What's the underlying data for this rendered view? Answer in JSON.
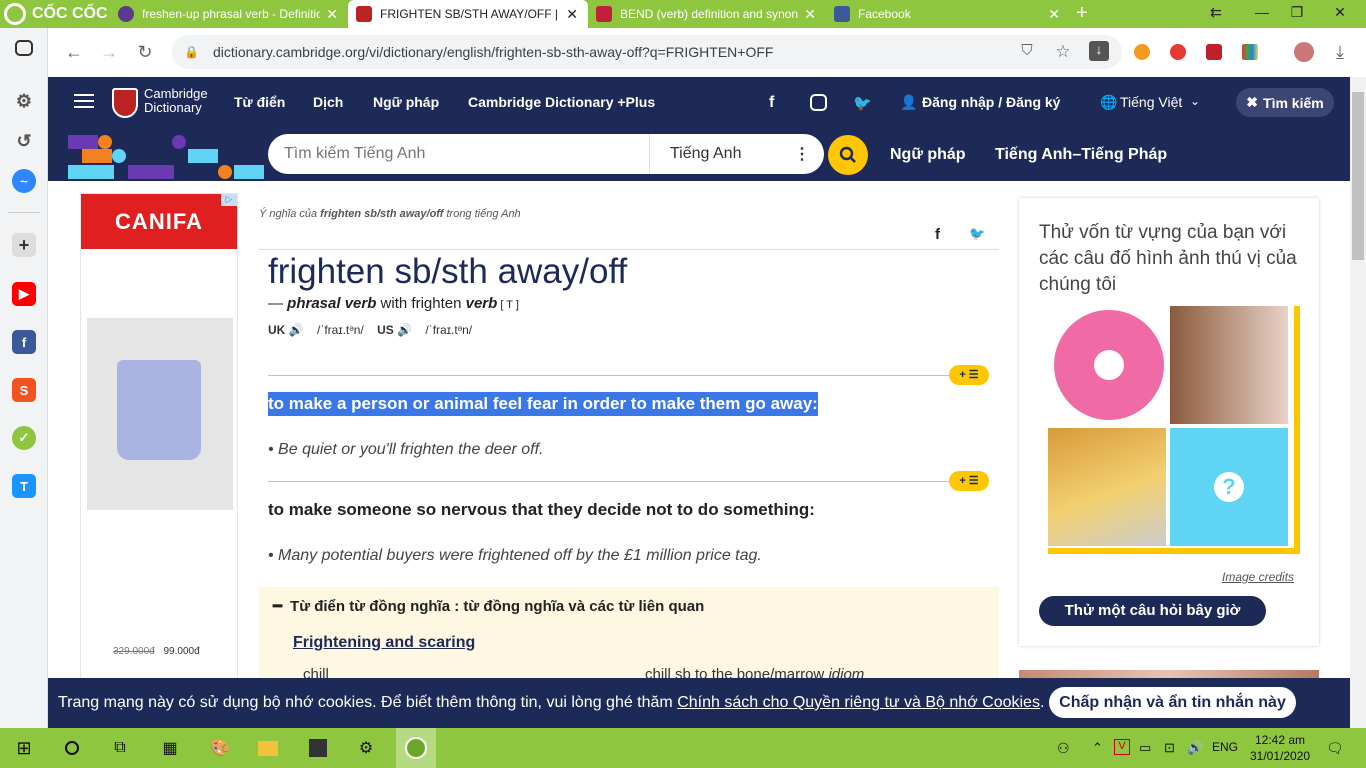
{
  "browser": {
    "logo": "CỐC CỐC",
    "tabs": [
      {
        "title": "freshen-up phrasal verb - Definitio",
        "active": false
      },
      {
        "title": "FRIGHTEN SB/STH AWAY/OFF | Đị",
        "active": true
      },
      {
        "title": "BEND (verb) definition and synony",
        "active": false
      },
      {
        "title": "Facebook",
        "active": false
      }
    ],
    "new_tab": "+",
    "url": "dictionary.cambridge.org/vi/dictionary/english/frighten-sb-sth-away-off?q=FRIGHTEN+OFF"
  },
  "site_header": {
    "brand_line1": "Cambridge",
    "brand_line2": "Dictionary",
    "nav": [
      "Từ điển",
      "Dịch",
      "Ngữ pháp",
      "Cambridge Dictionary +Plus"
    ],
    "login": "Đăng nhập / Đăng ký",
    "language": "Tiếng Việt",
    "search_button": "Tìm kiếm"
  },
  "search": {
    "placeholder": "Tìm kiếm Tiếng Anh",
    "dictionary_select": "Tiếng Anh",
    "links": [
      "Ngữ pháp",
      "Tiếng Anh–Tiếng Pháp"
    ]
  },
  "ad": {
    "brand": "CANIFA",
    "old_price": "329.000đ",
    "new_price": "99.000đ"
  },
  "entry": {
    "breadcrumb_prefix": "Ý nghĩa của ",
    "breadcrumb_word": "frighten sb/sth away/off",
    "breadcrumb_suffix": " trong tiếng Anh",
    "headword": "frighten sb/sth away/off",
    "pos_prefix": "— ",
    "pos": "phrasal verb",
    "pos_with": " with frighten ",
    "pos_verb": "verb",
    "pos_code": " [ T ]",
    "uk_label": "UK",
    "uk_ipa": "/ˈfraɪ.tᵊn/",
    "us_label": "US",
    "us_ipa": "/ˈfraɪ.tᵊn/",
    "badge": "+ ☰",
    "definitions": [
      {
        "text": "to make a person or animal feel fear in order to make them go away:",
        "example": "Be quiet or you'll frighten the deer off."
      },
      {
        "text": "to make someone so nervous that they decide not to do something:",
        "example": "Many potential buyers were frightened off by the £1 million price tag."
      }
    ],
    "thesaurus_title": "Từ điển từ đồng nghĩa : từ đồng nghĩa và các từ liên quan",
    "thesaurus_group": "Frightening and scaring",
    "thesaurus_items": [
      "chill",
      "chill sb to the bone/marrow"
    ],
    "thesaurus_item_tag": "idiom"
  },
  "quiz": {
    "title": "Thử vốn từ vựng của bạn với các câu đố hình ảnh thú vị của chúng tôi",
    "credits": "Image credits",
    "button": "Thử một câu hỏi bây giờ"
  },
  "cookie": {
    "text": "Trang mạng này có sử dụng bộ nhớ cookies. Để biết thêm thông tin, vui lòng ghé thăm ",
    "link": "Chính sách cho Quyền riêng tư và Bộ nhớ Cookies",
    "end": ".",
    "button": "Chấp nhận và ẩn tin nhắn này"
  },
  "taskbar": {
    "language": "ENG",
    "time": "12:42 am",
    "date": "31/01/2020"
  },
  "colors": {
    "browser_green": "#8ec63f",
    "cambridge_navy": "#1d2a57",
    "cambridge_yellow": "#ffc700",
    "highlight_blue": "#3b78e7"
  }
}
